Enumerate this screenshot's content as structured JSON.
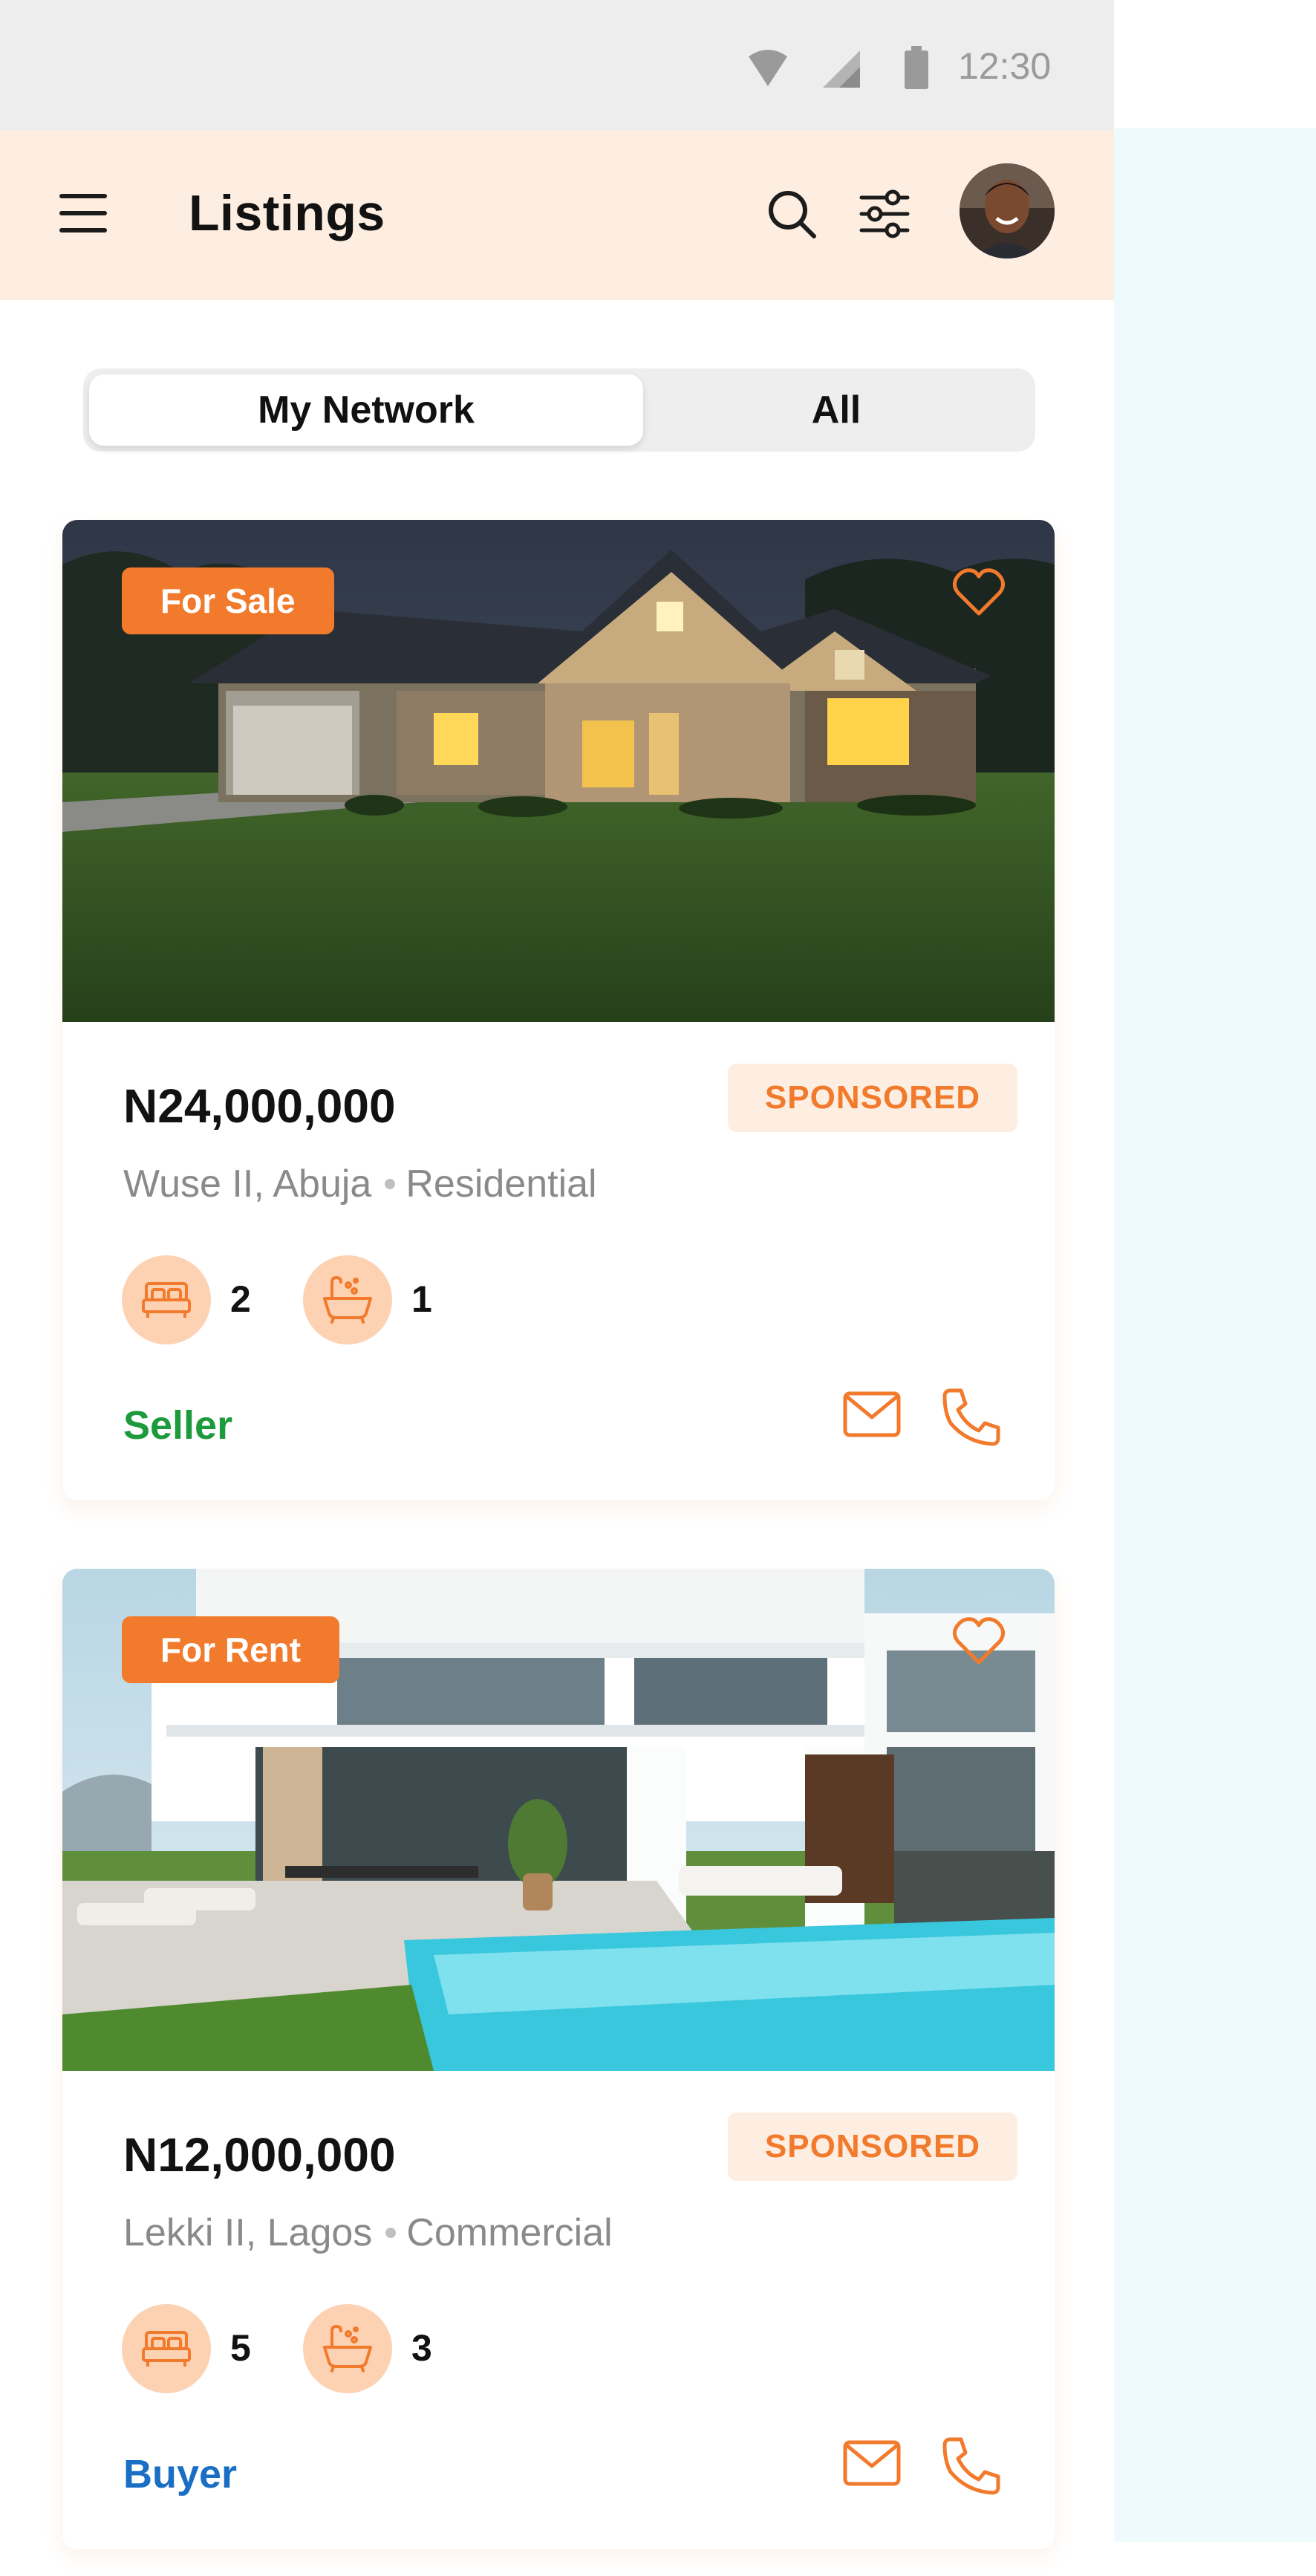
{
  "status_bar": {
    "time": "12:30"
  },
  "header": {
    "title": "Listings"
  },
  "tabs": [
    {
      "label": "My Network",
      "active": true
    },
    {
      "label": "All",
      "active": false
    }
  ],
  "colors": {
    "accent": "#f27a2c",
    "header_bg": "#fdeee1",
    "seller": "#1c9a3c",
    "buyer": "#1a6fc4"
  },
  "listings": [
    {
      "deal_type": "For Sale",
      "price": "N24,000,000",
      "badge": "SPONSORED",
      "area": "Wuse II, Abuja",
      "category": "Residential",
      "bedrooms": "2",
      "bathrooms": "1",
      "role": "Seller",
      "photo_icon": "house-night-photo"
    },
    {
      "deal_type": "For Rent",
      "price": "N12,000,000",
      "badge": "SPONSORED",
      "area": "Lekki II, Lagos",
      "category": "Commercial",
      "bedrooms": "5",
      "bathrooms": "3",
      "role": "Buyer",
      "photo_icon": "villa-pool-photo"
    }
  ]
}
